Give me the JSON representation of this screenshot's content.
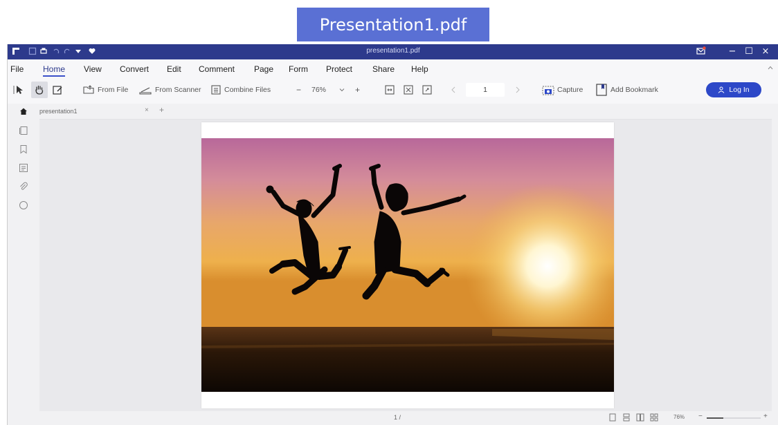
{
  "caption": "Presentation1.pdf",
  "titlebar": {
    "title": "presentation1.pdf"
  },
  "menu": [
    "File",
    "Home",
    "View",
    "Convert",
    "Edit",
    "Comment",
    "Page",
    "Form",
    "Protect",
    "Share",
    "Help"
  ],
  "active_menu": "Home",
  "toolbar": {
    "from_file": "From File",
    "from_scanner": "From Scanner",
    "combine_files": "Combine Files",
    "zoom_minus": "−",
    "zoom": "76%",
    "zoom_plus": "+",
    "page_number": "1",
    "capture": "Capture",
    "add_bookmark": "Add Bookmark",
    "login": "Log In"
  },
  "tab": {
    "name": "presentation1",
    "close": "×",
    "add": "+"
  },
  "status": {
    "page": "1 /",
    "zoom": "76%"
  },
  "colors": {
    "accent": "#2d3a8c",
    "caption_bg": "#5a70d4",
    "login": "#2d48c8"
  }
}
